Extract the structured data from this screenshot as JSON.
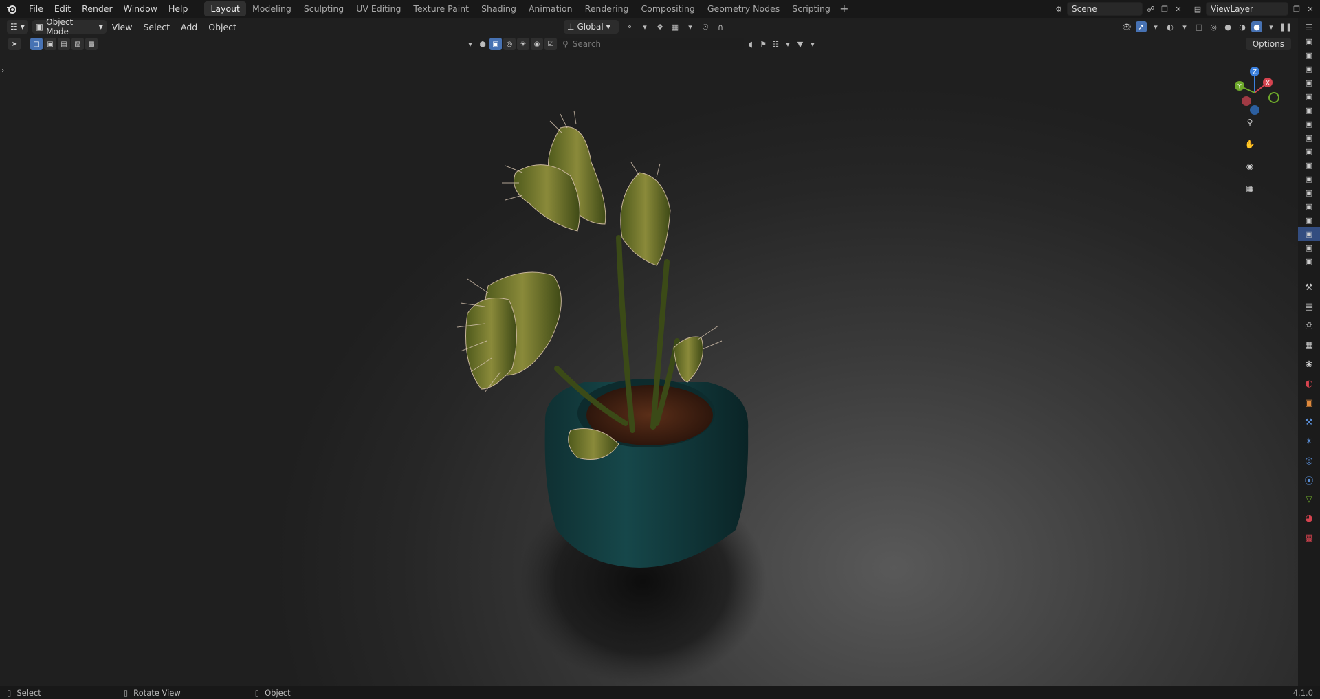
{
  "menu": [
    "File",
    "Edit",
    "Render",
    "Window",
    "Help"
  ],
  "workspaces": [
    "Layout",
    "Modeling",
    "Sculpting",
    "UV Editing",
    "Texture Paint",
    "Shading",
    "Animation",
    "Rendering",
    "Compositing",
    "Geometry Nodes",
    "Scripting"
  ],
  "active_workspace": "Layout",
  "scene": "Scene",
  "view_layer": "ViewLayer",
  "header": {
    "mode": "Object Mode",
    "menus": [
      "View",
      "Select",
      "Add",
      "Object"
    ],
    "transform_orientation": "Global"
  },
  "outliner_filter": {
    "search_placeholder": "Search",
    "options_label": "Options"
  },
  "gizmo": {
    "x": "X",
    "y": "Y",
    "z": "Z"
  },
  "status": {
    "select": "Select",
    "rotate": "Rotate View",
    "object": "Object",
    "version": "4.1.0"
  },
  "colors": {
    "accent": "#4772b3",
    "x_axis": "#d5434f",
    "y_axis": "#6ea92b",
    "z_axis": "#3a7fdc"
  }
}
